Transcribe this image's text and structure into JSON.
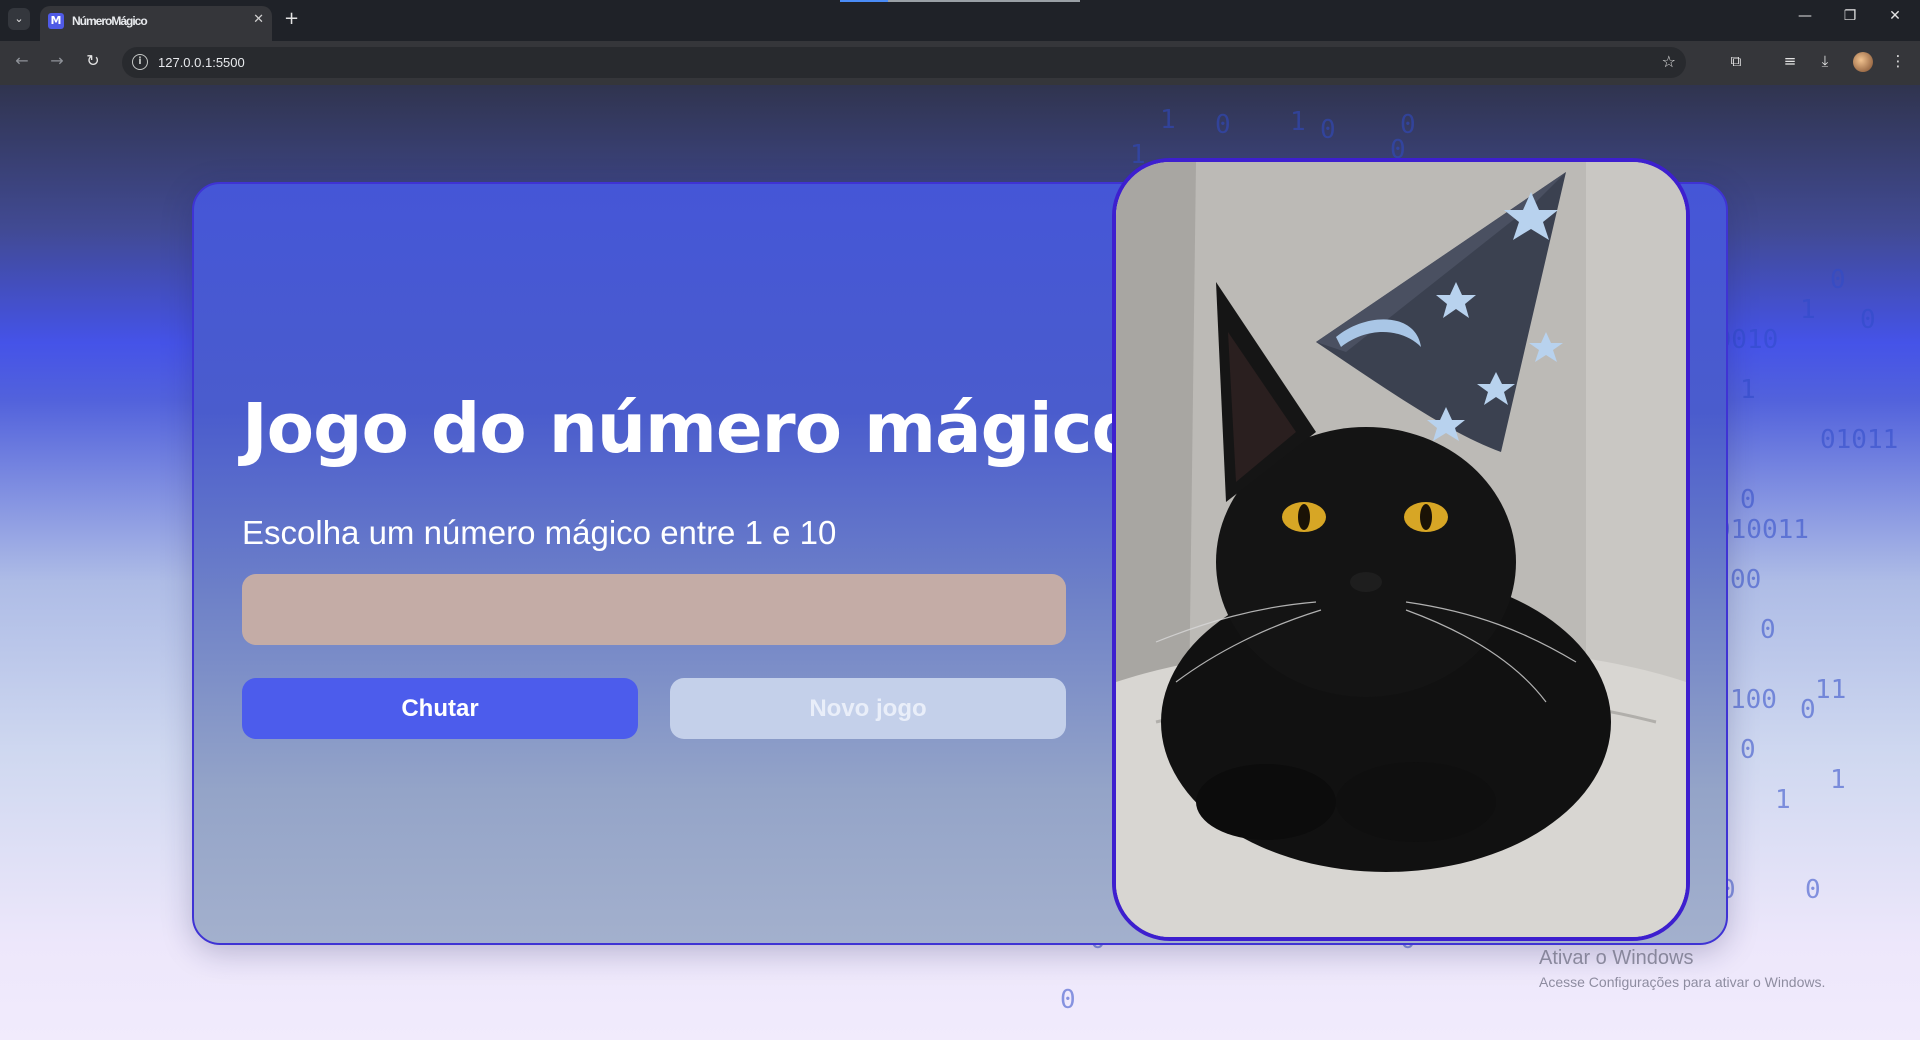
{
  "browser": {
    "tab_title": "NúmeroMágico",
    "tab_favicon_letter": "M",
    "url": "127.0.0.1:5500"
  },
  "page": {
    "title": "Jogo do número mágico",
    "subtitle": "Escolha um número mágico entre 1 e 10",
    "input": {
      "value": "",
      "placeholder": ""
    },
    "guess_button": "Chutar",
    "new_game_button": "Novo jogo",
    "image_description": "black cat wearing a wizard hat with stars and moon"
  },
  "background_digits": [
    "1",
    "0",
    "1",
    "0",
    "0",
    "1",
    "0",
    "01",
    "0",
    "10",
    "0",
    "1",
    "0",
    "1",
    "00010",
    "0",
    "1",
    "0",
    "01011",
    "0",
    "010011",
    "00",
    "0",
    "11",
    "100",
    "0",
    "0",
    "1",
    "1",
    "0",
    "0",
    "0",
    "0",
    "0"
  ],
  "watermark": {
    "line1": "Ativar o Windows",
    "line2": "Acesse Configurações para ativar o Windows."
  },
  "colors": {
    "accent": "#4c5cec",
    "card_border": "#3f33d4",
    "photo_border": "#3d1fcf",
    "input_bg": "#c4aca6",
    "secondary_button": "#c4d0ea"
  }
}
